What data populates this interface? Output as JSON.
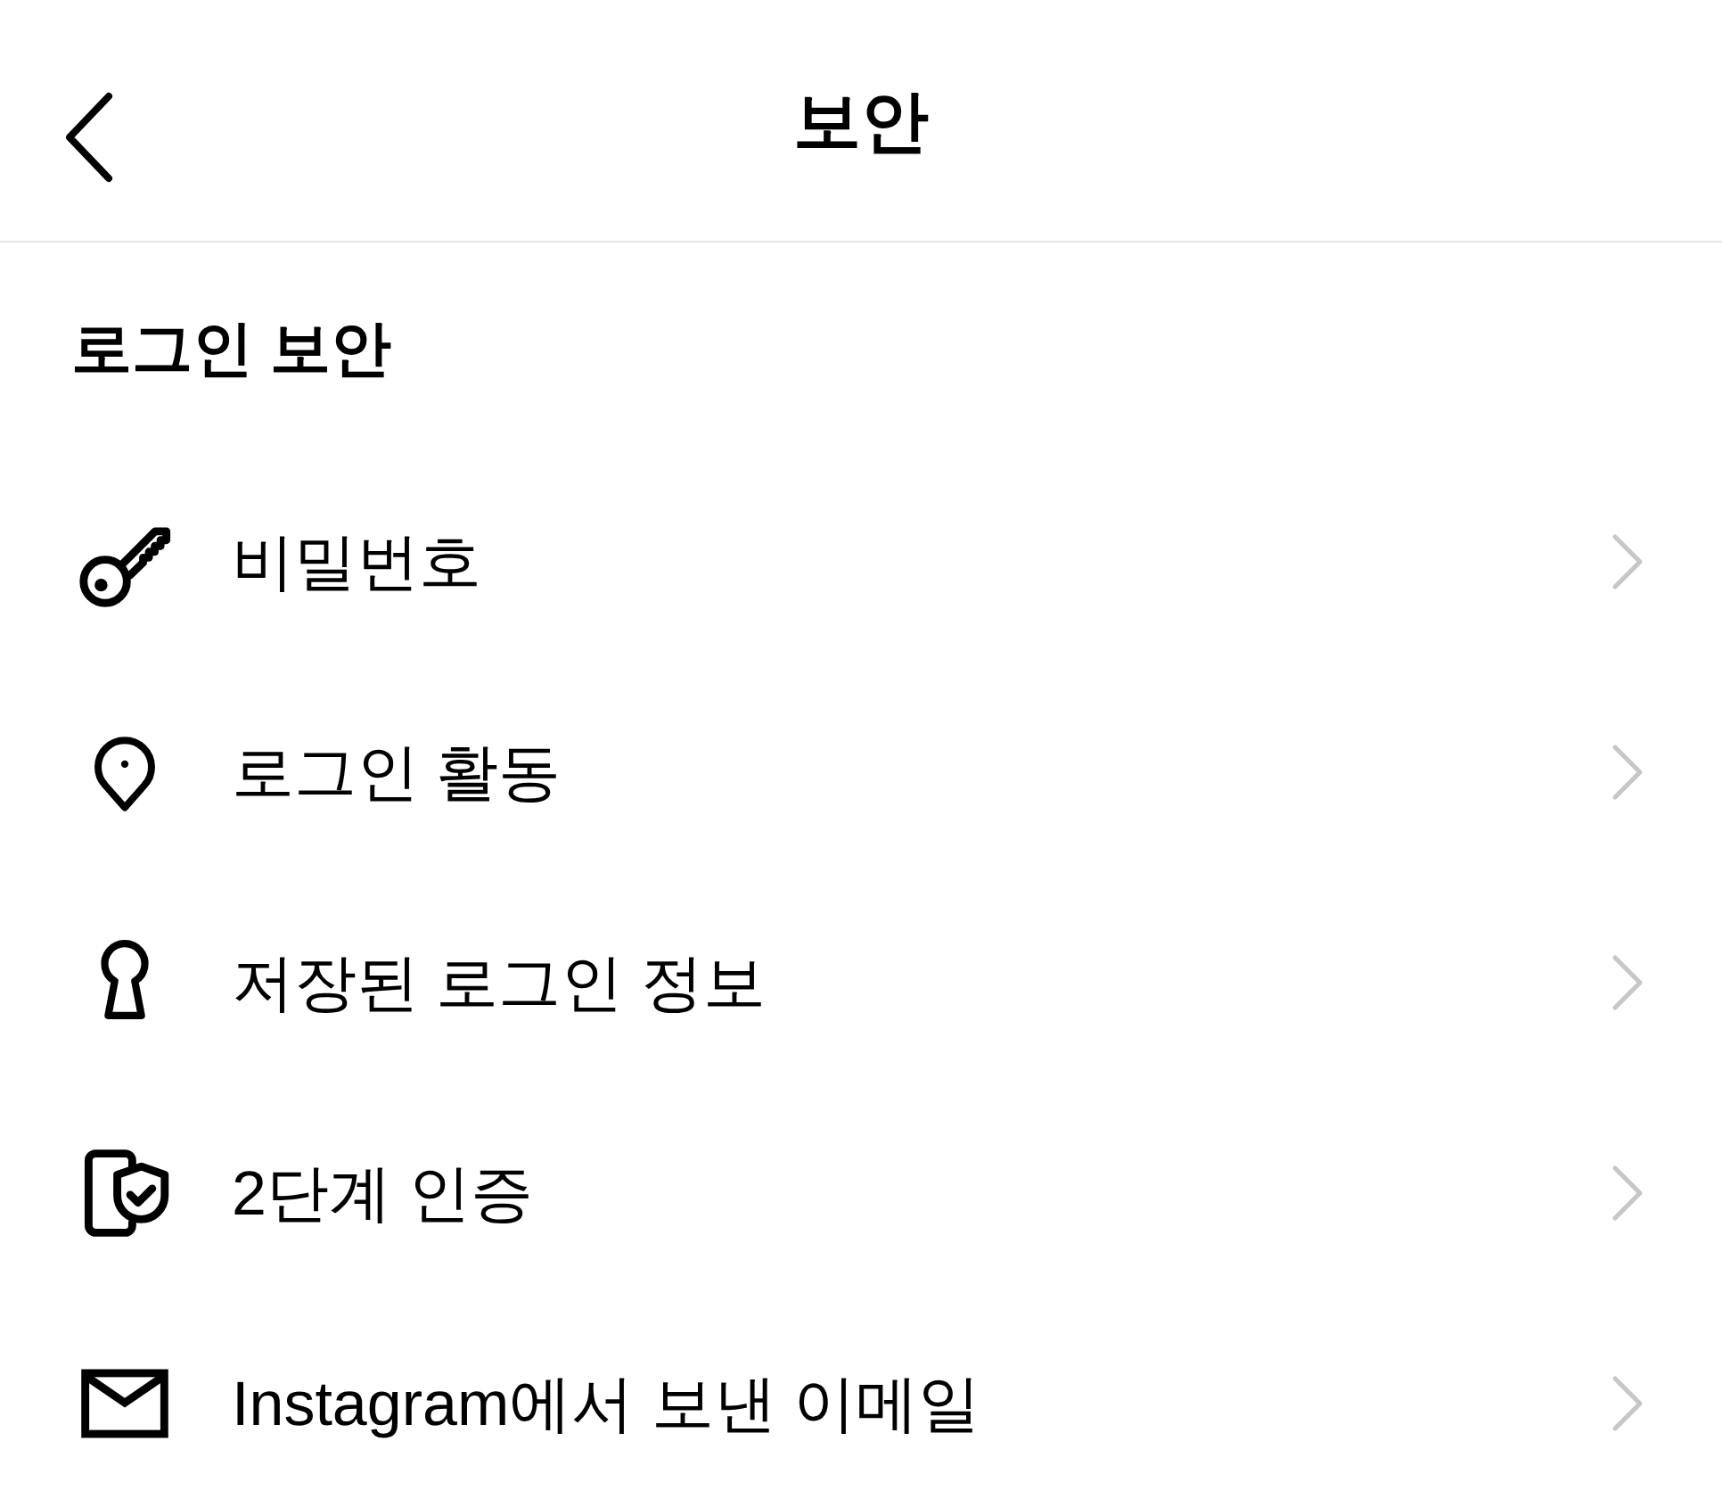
{
  "header": {
    "title": "보안"
  },
  "section": {
    "title": "로그인 보안"
  },
  "items": [
    {
      "label": "비밀번호"
    },
    {
      "label": "로그인 활동"
    },
    {
      "label": "저장된 로그인 정보"
    },
    {
      "label": "2단계 인증"
    },
    {
      "label": "Instagram에서 보낸 이메일"
    }
  ]
}
